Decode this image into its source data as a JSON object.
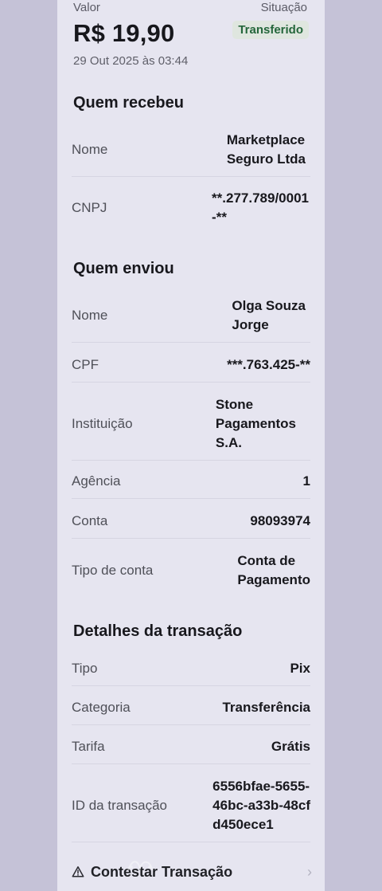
{
  "header": {
    "valor_label": "Valor",
    "situacao_label": "Situação",
    "amount": "R$ 19,90",
    "status": "Transferido",
    "datetime": "29 Out 2025 às 03:44"
  },
  "sections": {
    "receiver": {
      "title": "Quem recebeu",
      "rows": [
        {
          "label": "Nome",
          "value": "Marketplace\nSeguro Ltda"
        },
        {
          "label": "CNPJ",
          "value": "**.277.789/0001\n-**"
        }
      ]
    },
    "sender": {
      "title": "Quem enviou",
      "rows": [
        {
          "label": "Nome",
          "value": "Olga Souza\nJorge"
        },
        {
          "label": "CPF",
          "value": "***.763.425-**"
        },
        {
          "label": "Instituição",
          "value": "Stone\nPagamentos\nS.A."
        },
        {
          "label": "Agência",
          "value": "1"
        },
        {
          "label": "Conta",
          "value": "98093974"
        },
        {
          "label": "Tipo de conta",
          "value": "Conta de\nPagamento"
        }
      ]
    },
    "transaction": {
      "title": "Detalhes da transação",
      "rows": [
        {
          "label": "Tipo",
          "value": "Pix"
        },
        {
          "label": "Categoria",
          "value": "Transferência"
        },
        {
          "label": "Tarifa",
          "value": "Grátis"
        },
        {
          "label": "ID da transação",
          "value": "6556bfae-5655-\n46bc-a33b-48cf\nd450ece1"
        }
      ]
    }
  },
  "action": {
    "label": "Contestar Transação",
    "icon": "warning-icon",
    "chevron": "›"
  },
  "colors": {
    "background": "#c9c6da",
    "card": "#e6e5f0",
    "status_green": "#24663b"
  }
}
